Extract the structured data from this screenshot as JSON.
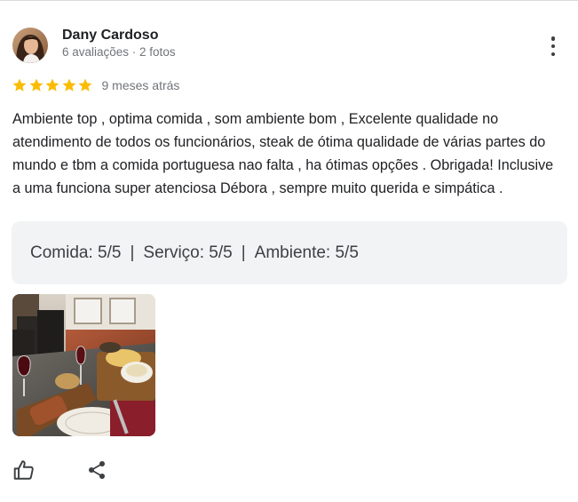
{
  "reviewer": {
    "name": "Dany Cardoso",
    "meta": "6 avaliações · 2 fotos"
  },
  "rating": {
    "stars": 5,
    "max_stars": 5,
    "timestamp": "9 meses atrás",
    "star_color": "#fbbc04"
  },
  "review": {
    "text": "Ambiente top , optima comida , som ambiente bom , Excelente qualidade no atendimento de todos os funcionários, steak de ótima qualidade de várias partes do mundo e tbm a comida portuguesa nao falta , ha ótimas opções . Obrigada! Inclusive a uma funciona super atenciosa Débora , sempre muito querida e simpática ."
  },
  "sub_ratings": {
    "food": "Comida: 5/5",
    "service": "Serviço: 5/5",
    "ambience": "Ambiente: 5/5",
    "separator": "|"
  },
  "icons": {
    "more": "more-vert-icon",
    "like": "thumb-up-icon",
    "share": "share-icon"
  }
}
